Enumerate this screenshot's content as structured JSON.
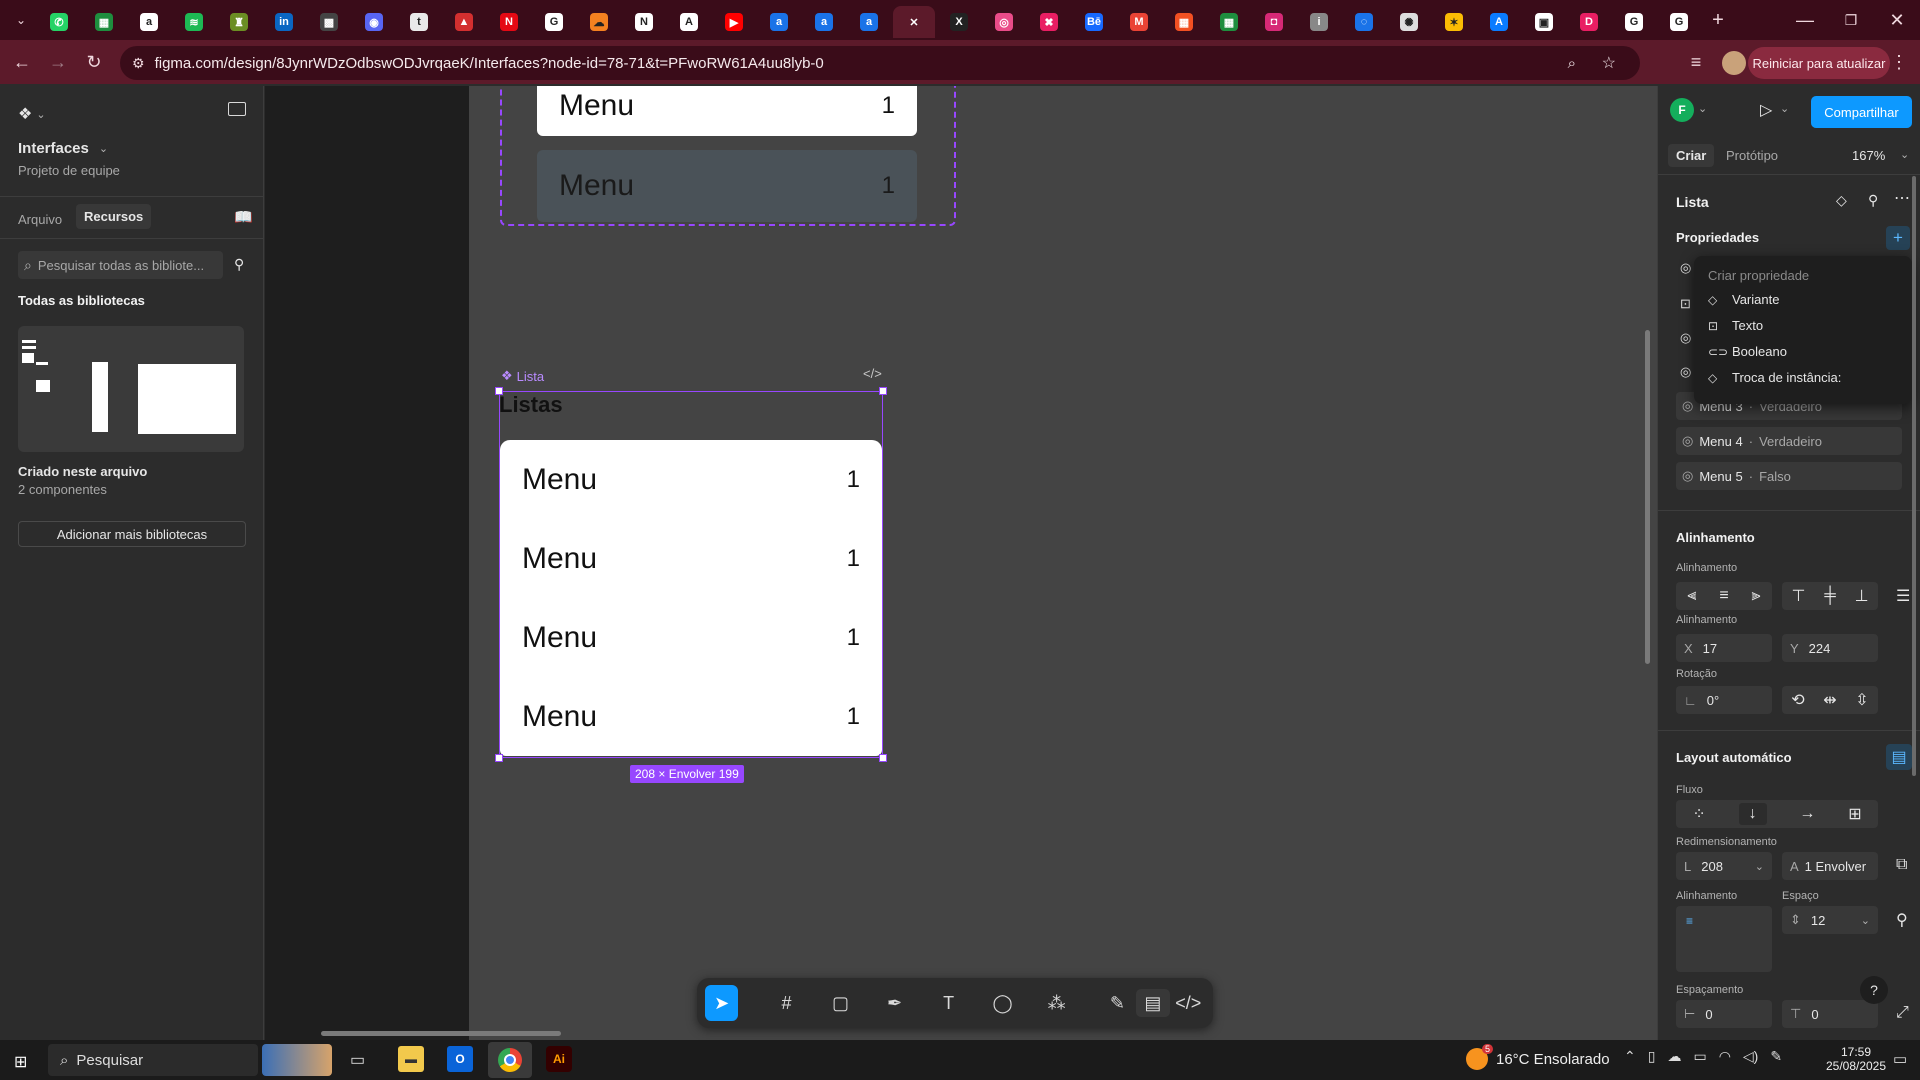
{
  "browser": {
    "url": "figma.com/design/8JynrWDzOdbswODJvrqaeK/Interfaces?node-id=78-71&t=PFwoRW61A4uu8lyb-0",
    "update_label": "Reiniciar para atualizar",
    "tabs": [
      {
        "icon": "whatsapp-icon",
        "color": "#25d366",
        "glyph": "✆"
      },
      {
        "icon": "sheets-icon",
        "color": "#1e8e3e",
        "glyph": "▦"
      },
      {
        "icon": "amazon-icon",
        "color": "#ffffff",
        "glyph": "a"
      },
      {
        "icon": "spotify-icon",
        "color": "#1db954",
        "glyph": "≋"
      },
      {
        "icon": "crest-icon",
        "color": "#6b8e23",
        "glyph": "♜"
      },
      {
        "icon": "linkedin-icon",
        "color": "#0a66c2",
        "glyph": "in"
      },
      {
        "icon": "grid-app-icon",
        "color": "#444444",
        "glyph": "▩"
      },
      {
        "icon": "discord-icon",
        "color": "#5865f2",
        "glyph": "◉"
      },
      {
        "icon": "tumblr-icon",
        "color": "#e9e9e9",
        "glyph": "t"
      },
      {
        "icon": "acrobat-icon",
        "color": "#d32f2f",
        "glyph": "▲"
      },
      {
        "icon": "netflix-icon",
        "color": "#e50914",
        "glyph": "N"
      },
      {
        "icon": "google-icon",
        "color": "#ffffff",
        "glyph": "G"
      },
      {
        "icon": "cloud-app-icon",
        "color": "#f48120",
        "glyph": "☁"
      },
      {
        "icon": "notion-icon",
        "color": "#ffffff",
        "glyph": "N"
      },
      {
        "icon": "app-a-icon",
        "color": "#ffffff",
        "glyph": "A"
      },
      {
        "icon": "youtube-icon",
        "color": "#ff0000",
        "glyph": "▶"
      },
      {
        "icon": "letter-a-icon",
        "color": "#1a73e8",
        "glyph": "a"
      },
      {
        "icon": "letter-a-icon",
        "color": "#1a73e8",
        "glyph": "a"
      },
      {
        "icon": "letter-a-icon",
        "color": "#1a73e8",
        "glyph": "a"
      },
      {
        "icon": "figma-tab-close-icon",
        "color": "#5c1a2a",
        "glyph": "✕"
      },
      {
        "icon": "x-app-icon",
        "color": "#222222",
        "glyph": "X"
      },
      {
        "icon": "dribbble-icon",
        "color": "#ea4c89",
        "glyph": "◎"
      },
      {
        "icon": "app-x-icon",
        "color": "#e91e63",
        "glyph": "✖"
      },
      {
        "icon": "behance-icon",
        "color": "#1769ff",
        "glyph": "Bē"
      },
      {
        "icon": "gmail-icon",
        "color": "#ea4335",
        "glyph": "M"
      },
      {
        "icon": "microsoft-icon",
        "color": "#f25022",
        "glyph": "▦"
      },
      {
        "icon": "sheets-icon",
        "color": "#1e8e3e",
        "glyph": "▦"
      },
      {
        "icon": "instagram-icon",
        "color": "#d62976",
        "glyph": "◘"
      },
      {
        "icon": "info-icon",
        "color": "#888888",
        "glyph": "i"
      },
      {
        "icon": "loader-icon",
        "color": "#1a73e8",
        "glyph": "◌"
      },
      {
        "icon": "openai-icon",
        "color": "#dddddd",
        "glyph": "✺"
      },
      {
        "icon": "star-app-icon",
        "color": "#fbbc04",
        "glyph": "✶"
      },
      {
        "icon": "app-icon",
        "color": "#0a7cff",
        "glyph": "A"
      },
      {
        "icon": "qr-icon",
        "color": "#ffffff",
        "glyph": "▣"
      },
      {
        "icon": "app-d-icon",
        "color": "#e91e63",
        "glyph": "D"
      },
      {
        "icon": "google-icon",
        "color": "#ffffff",
        "glyph": "G"
      },
      {
        "icon": "google-icon",
        "color": "#ffffff",
        "glyph": "G"
      }
    ]
  },
  "left_panel": {
    "file_name": "Interfaces",
    "project": "Projeto de equipe",
    "tab_file": "Arquivo",
    "tab_assets": "Recursos",
    "search_placeholder": "Pesquisar todas as bibliote...",
    "all_libraries": "Todas as bibliotecas",
    "created_here": "Criado neste arquivo",
    "components_count": "2 componentes",
    "add_libraries": "Adicionar mais bibliotecas"
  },
  "canvas": {
    "top_cards": [
      {
        "label": "Menu",
        "count": "1"
      },
      {
        "label": "Menu",
        "count": "1"
      }
    ],
    "component_label": "Lista",
    "heading": "Listas",
    "list_cards": [
      {
        "label": "Menu",
        "count": "1"
      },
      {
        "label": "Menu",
        "count": "1"
      },
      {
        "label": "Menu",
        "count": "1"
      },
      {
        "label": "Menu",
        "count": "1"
      }
    ],
    "size_badge": "208 × Envolver  199"
  },
  "toolbar_tools": [
    "move-tool-icon",
    "frame-tool-icon",
    "shape-tool-icon",
    "pen-tool-icon",
    "text-tool-icon",
    "comment-tool-icon",
    "actions-tool-icon",
    "draw-mode-icon",
    "design-mode-icon",
    "dev-mode-icon"
  ],
  "right_panel": {
    "avatar_letter": "F",
    "share_label": "Compartilhar",
    "tab_design": "Criar",
    "tab_prototype": "Protótipo",
    "zoom": "167%",
    "layer_name": "Lista",
    "properties_title": "Propriedades",
    "dropdown": {
      "title": "Criar propriedade",
      "items": [
        "Variante",
        "Texto",
        "Booleano",
        "Troca de instância:"
      ]
    },
    "props": [
      {
        "name": "Menu 3",
        "value": "Verdadeiro"
      },
      {
        "name": "Menu 4",
        "value": "Verdadeiro"
      },
      {
        "name": "Menu 5",
        "value": "Falso"
      }
    ],
    "alignment_title": "Alinhamento",
    "alignment_sub": "Alinhamento",
    "position_sub": "Alinhamento",
    "x_label": "X",
    "x_value": "17",
    "y_label": "Y",
    "y_value": "224",
    "rotation_sub": "Rotação",
    "rotation_value": "0°",
    "autolayout_title": "Layout automático",
    "flow_sub": "Fluxo",
    "resize_sub": "Redimensionamento",
    "width_label": "L",
    "width_value": "208",
    "height_label": "A",
    "height_value": "1 Envolver",
    "align_sub": "Alinhamento",
    "gap_sub": "Espaço",
    "gap_value": "12",
    "padding_sub": "Espaçamento",
    "pad_h": "0",
    "pad_v": "0"
  },
  "taskbar": {
    "search": "Pesquisar",
    "weather": "16°C  Ensolarado",
    "time": "17:59",
    "date": "25/08/2025",
    "notif": "5"
  }
}
